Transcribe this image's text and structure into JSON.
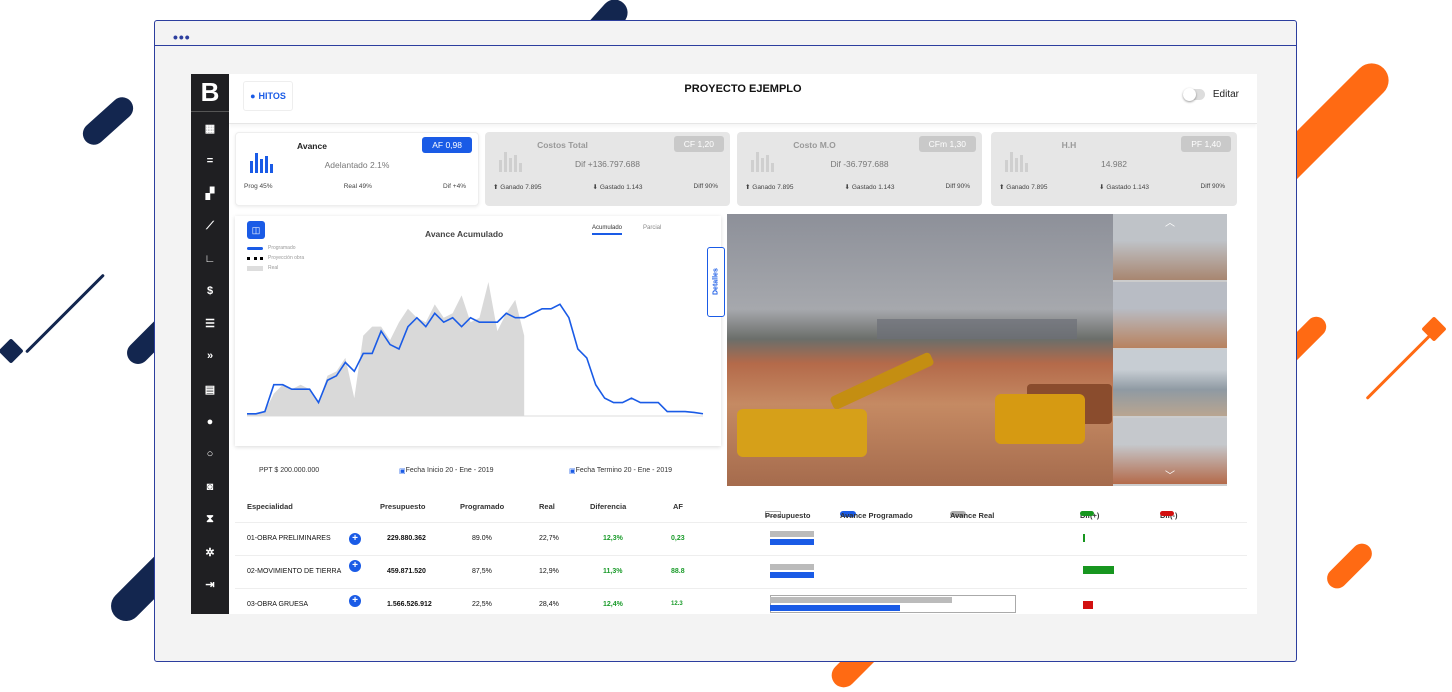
{
  "brand": {
    "logo_letter": "B"
  },
  "topbar": {
    "hitos_label": "HITOS",
    "project_title": "PROYECTO EJEMPLO",
    "edit_label": "Editar"
  },
  "kpis": [
    {
      "title": "Avance",
      "badge": "AF 0,98",
      "main": "Adelantado 2.1%",
      "foot": [
        "Prog 45%",
        "Real 49%",
        "Dif +4%"
      ]
    },
    {
      "title": "Costos Total",
      "badge": "CF 1,20",
      "main": "Dif +136.797.688",
      "foot": [
        "Ganado 7.895",
        "Gastado 1.143",
        "Diff 90%"
      ]
    },
    {
      "title": "Costo M.O",
      "badge": "CFm 1,30",
      "main": "Dif -36.797.688",
      "foot": [
        "Ganado 7.895",
        "Gastado 1.143",
        "Diff 90%"
      ]
    },
    {
      "title": "H.H",
      "badge": "PF 1,40",
      "main": "14.982",
      "foot": [
        "Ganado 7.895",
        "Gastado 1.143",
        "Diff 90%"
      ]
    }
  ],
  "chart": {
    "title": "Avance Acumulado",
    "tabs": [
      "Acumulado",
      "Parcial"
    ],
    "legend": [
      "Programado",
      "Proyección obra",
      "Real"
    ],
    "details_label": "Detalles"
  },
  "chart_data": {
    "type": "area",
    "title": "Avance Acumulado",
    "series": [
      {
        "name": "Programado",
        "values": [
          0.5,
          0.5,
          1,
          7,
          7,
          6,
          6,
          6,
          3,
          8,
          9,
          12,
          10,
          14,
          14,
          19,
          16,
          15,
          20,
          22,
          20,
          23,
          21,
          22,
          20,
          22,
          21,
          21,
          21,
          23,
          22,
          22,
          23,
          24,
          24,
          25,
          22,
          15,
          13,
          7,
          4,
          3,
          3,
          4,
          3,
          3,
          3,
          1,
          1,
          1,
          0.8,
          0.5
        ]
      },
      {
        "name": "Real",
        "values": [
          0.5,
          0.5,
          1,
          5,
          7,
          6,
          7,
          6,
          3,
          9,
          10,
          13,
          4,
          18,
          20,
          20,
          17,
          21,
          24,
          22,
          21,
          25,
          22,
          23,
          27,
          21,
          22,
          30,
          19,
          23,
          26,
          18,
          0,
          0,
          0,
          0,
          0,
          0,
          0,
          0,
          0,
          0,
          0,
          0,
          0,
          0,
          0,
          0,
          0,
          0,
          0,
          0
        ]
      }
    ]
  },
  "summary": {
    "ppt": "PPT  $ 200.000.000",
    "fecha_inicio": "Fecha Inicio  20 - Ene - 2019",
    "fecha_termino": "Fecha Termino  20 - Ene - 2019"
  },
  "table": {
    "headers": [
      "Especialidad",
      "Presupuesto",
      "Programado",
      "Real",
      "Diferencia",
      "AF"
    ],
    "bar_legend": [
      "Presupuesto",
      "Avance Programado",
      "Avance Real"
    ],
    "dif_labels": [
      "Dif(+)",
      "Dif(-)"
    ],
    "rows": [
      {
        "especialidad": "01-OBRA PRELIMINARES",
        "presupuesto": "229.880.362",
        "programado": "89.0%",
        "real": "22,7%",
        "diferencia": "12,3%",
        "af": "0,23",
        "prog_frac": 0.18,
        "real_frac": 0.18,
        "dif": "pos",
        "dif_frac": 0.01
      },
      {
        "especialidad": "02-MOVIMIENTO DE TIERRA",
        "presupuesto": "459.871.520",
        "programado": "87,5%",
        "real": "12,9%",
        "diferencia": "11,3%",
        "af": "88.8",
        "prog_frac": 0.18,
        "real_frac": 0.18,
        "dif": "pos",
        "dif_frac": 0.6
      },
      {
        "especialidad": "03-OBRA GRUESA",
        "presupuesto": "1.566.526.912",
        "programado": "22,5%",
        "real": "28,4%",
        "diferencia": "12,4%",
        "af": "12.3",
        "prog_frac": 0.53,
        "real_frac": 0.74,
        "dif": "neg",
        "dif_frac": 0.2
      }
    ]
  },
  "colors": {
    "accent": "#1a5be6",
    "sidebar": "#1f1f22",
    "positive": "#17961f",
    "negative": "#d21010",
    "deco_navy": "#13264f",
    "deco_orange": "#ff6a13"
  }
}
